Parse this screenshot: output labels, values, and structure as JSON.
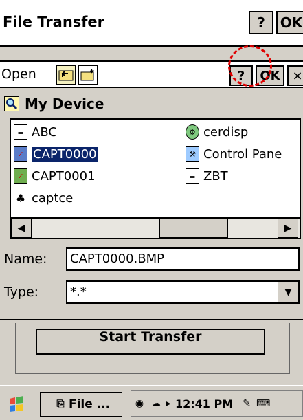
{
  "window": {
    "title": "File Transfer",
    "help_label": "?",
    "ok_label": "OK"
  },
  "dialog": {
    "open_label": "Open",
    "help_label": "?",
    "ok_label": "OK",
    "close_label": "×",
    "location": "My Device",
    "files": [
      {
        "name": "ABC",
        "icon": "notepad-icon"
      },
      {
        "name": "cerdisp",
        "icon": "colorwheel-icon"
      },
      {
        "name": "CAPT0000",
        "icon": "bitmap-icon",
        "selected": true
      },
      {
        "name": "Control Pane",
        "icon": "control-panel-icon"
      },
      {
        "name": "CAPT0001",
        "icon": "bitmap-icon"
      },
      {
        "name": "ZBT",
        "icon": "notepad-icon"
      },
      {
        "name": "captce",
        "icon": "app-icon"
      }
    ],
    "name_label": "Name:",
    "name_value": "CAPT0000.BMP",
    "type_label": "Type:",
    "type_value": "*.*"
  },
  "main": {
    "start_transfer_label": "Start Transfer"
  },
  "taskbar": {
    "start_icon": "windows-flag-icon",
    "task_label": "File ...",
    "clock": "12:41 PM"
  },
  "colors": {
    "selection": "#0a246a",
    "annotation": "#e00000",
    "chrome": "#d4d0c8"
  }
}
